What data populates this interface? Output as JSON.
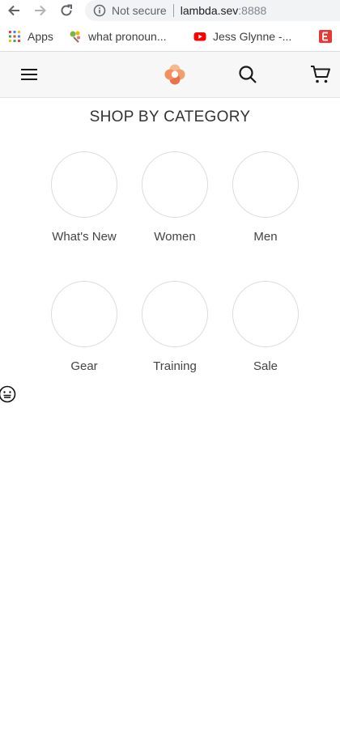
{
  "browser": {
    "security_label": "Not secure",
    "url_host": "lambda.sev",
    "url_port": ":8888"
  },
  "bookmarks": {
    "items": [
      {
        "label": "Apps",
        "icon": "apps-grid-icon"
      },
      {
        "label": "what pronoun...",
        "icon": "wand-icon"
      },
      {
        "label": "Jess Glynne -...",
        "icon": "youtube-icon"
      },
      {
        "label": "",
        "icon": "red-e-icon"
      }
    ]
  },
  "header": {
    "menu_icon": "hamburger-icon",
    "logo": "brand-logo-icon",
    "search_icon": "search-icon",
    "cart_icon": "cart-icon",
    "colors": {
      "logo_light": "#f6b98f",
      "logo_dark": "#e8734a",
      "header_bg": "#f7f7f7"
    }
  },
  "main": {
    "heading": "SHOP BY CATEGORY",
    "categories": [
      {
        "label": "What's New"
      },
      {
        "label": "Women"
      },
      {
        "label": "Men"
      },
      {
        "label": "Gear"
      },
      {
        "label": "Training"
      },
      {
        "label": "Sale"
      }
    ]
  },
  "misc": {
    "floating_icon": "smiley-face-icon"
  }
}
